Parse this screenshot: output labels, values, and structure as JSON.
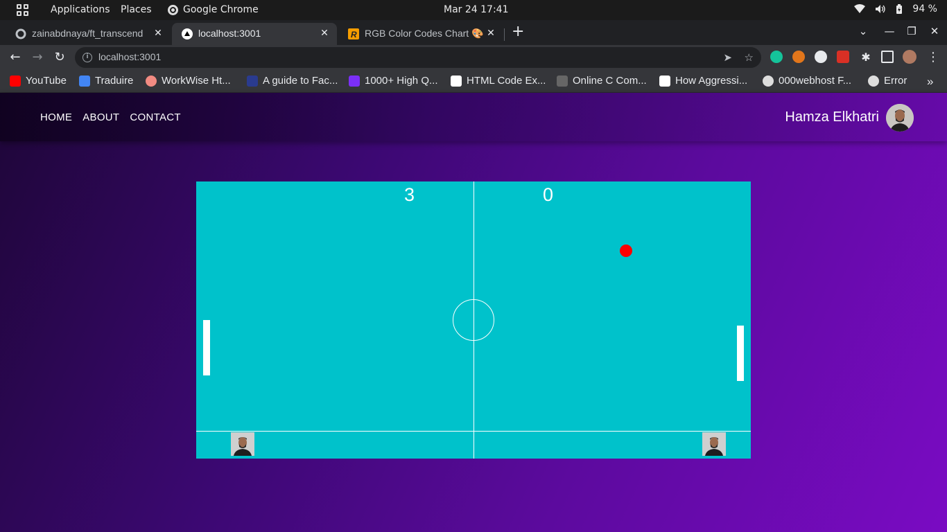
{
  "system_bar": {
    "applications": "Applications",
    "places": "Places",
    "active_app": "Google Chrome",
    "datetime": "Mar 24  17:41",
    "battery": "94 %"
  },
  "browser": {
    "tabs": [
      {
        "label": "zainabdnaya/ft_transcend",
        "favicon": "github-icon"
      },
      {
        "label": "localhost:3001",
        "favicon": "triangle-icon",
        "active": true
      },
      {
        "label": "RGB Color Codes Chart 🎨",
        "favicon": "r-logo-icon"
      }
    ],
    "url": "localhost:3001",
    "bookmarks": [
      {
        "label": "YouTube",
        "color": "#ff0000"
      },
      {
        "label": "Traduire",
        "color": "#4285f4"
      },
      {
        "label": "WorkWise Ht...",
        "color": "#f28b82"
      },
      {
        "label": "A guide to Fac...",
        "color": "#2a3b8f"
      },
      {
        "label": "1000+ High Q...",
        "color": "#7b2ff7"
      },
      {
        "label": "HTML Code Ex...",
        "color": "#ffffff"
      },
      {
        "label": "Online C Com...",
        "color": "#666666"
      },
      {
        "label": "How Aggressi...",
        "color": "#ffffff"
      },
      {
        "label": "000webhost F...",
        "color": "#dddddd"
      },
      {
        "label": "Error",
        "color": "#dddddd"
      }
    ]
  },
  "site": {
    "nav": [
      "HOME",
      "ABOUT",
      "CONTACT"
    ],
    "user_name": "Hamza Elkhatri"
  },
  "game": {
    "score_left": "3",
    "score_right": "0",
    "colors": {
      "field": "#00c2cb",
      "ball": "#ff0000",
      "lines": "#ffffff"
    }
  }
}
